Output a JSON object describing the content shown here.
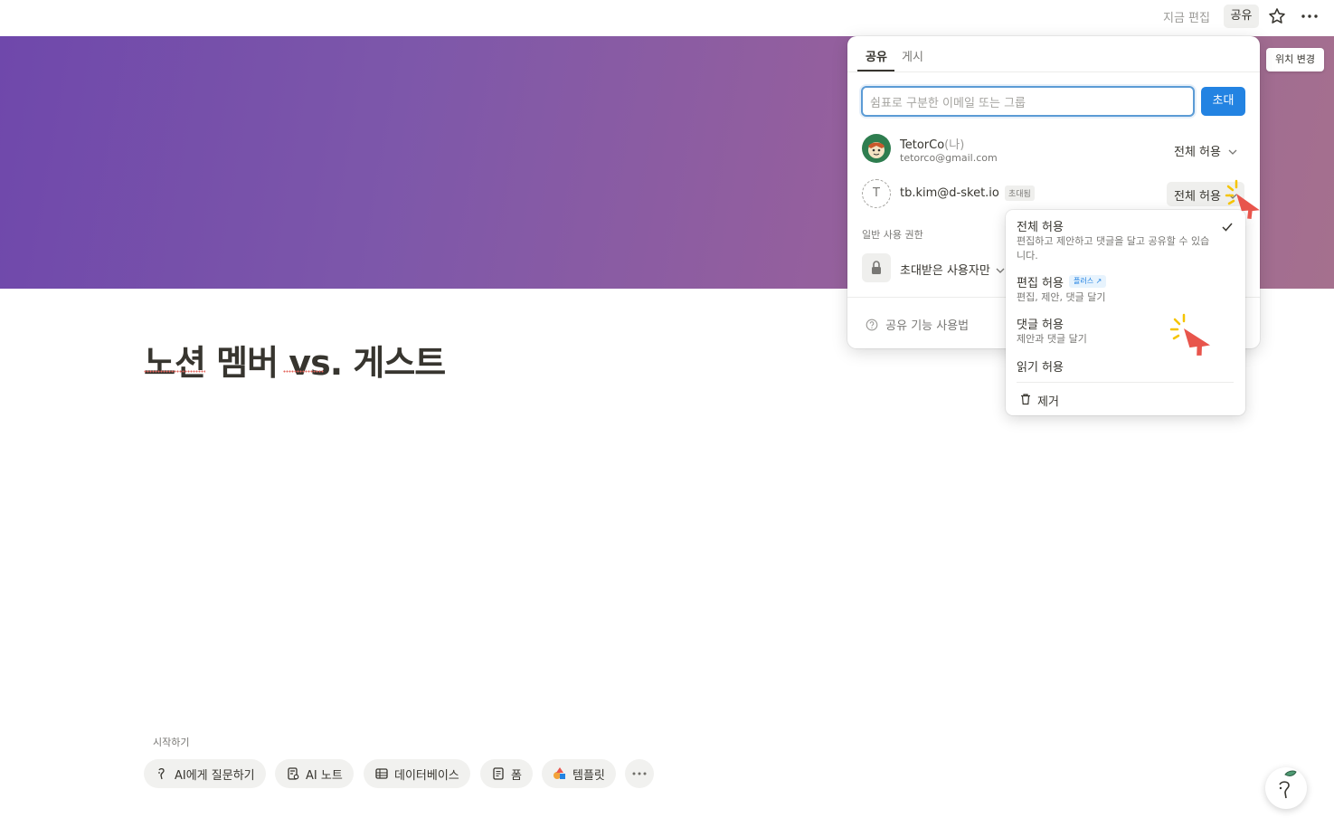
{
  "topbar": {
    "edit_time": "지금 편집",
    "share_label": "공유",
    "star_icon": "star-icon",
    "more_icon": "more-horizontal-icon"
  },
  "cover": {
    "change_cover_label": "위치 변경"
  },
  "page": {
    "title": "노션 멤버 vs. 게스트"
  },
  "get_started": {
    "label": "시작하기",
    "chips": [
      {
        "label": "AI에게 질문하기",
        "icon": "ai-face-icon"
      },
      {
        "label": "AI 노트",
        "icon": "ai-note-icon"
      },
      {
        "label": "데이터베이스",
        "icon": "table-icon"
      },
      {
        "label": "폼",
        "icon": "form-icon"
      },
      {
        "label": "템플릿",
        "icon": "shapes-icon"
      }
    ],
    "more_icon": "more-horizontal-icon"
  },
  "share_panel": {
    "tabs": [
      {
        "label": "공유",
        "active": true
      },
      {
        "label": "게시",
        "active": false
      }
    ],
    "invite": {
      "placeholder": "쉼표로 구분한 이메일 또는 그룹",
      "button": "초대"
    },
    "members": [
      {
        "name": "TetorCo",
        "suffix": "(나)",
        "email": "tetorco@gmail.com",
        "permission": "전체 허용"
      },
      {
        "name": "tb.kim@d-sket.io",
        "initial": "T",
        "badge": "초대됨",
        "permission": "전체 허용"
      }
    ],
    "general_access": {
      "label": "일반 사용 권한",
      "value": "초대받은 사용자만"
    },
    "footer": {
      "help_label": "공유 기능 사용법"
    }
  },
  "permission_menu": {
    "items": [
      {
        "title": "전체 허용",
        "description": "편집하고 제안하고 댓글을 달고 공유할 수 있습니다.",
        "checked": true
      },
      {
        "title": "편집 허용",
        "badge": "플러스 ↗",
        "description": "편집, 제안, 댓글 달기"
      },
      {
        "title": "댓글 허용",
        "description": "제안과 댓글 달기"
      },
      {
        "title": "읽기 허용",
        "description": ""
      }
    ],
    "remove_label": "제거"
  },
  "colors": {
    "accent": "#2383e2",
    "cover_start": "#6f48ab",
    "cover_end": "#a5708e",
    "cursor": "#e8554c",
    "sparkle": "#f5c400"
  }
}
